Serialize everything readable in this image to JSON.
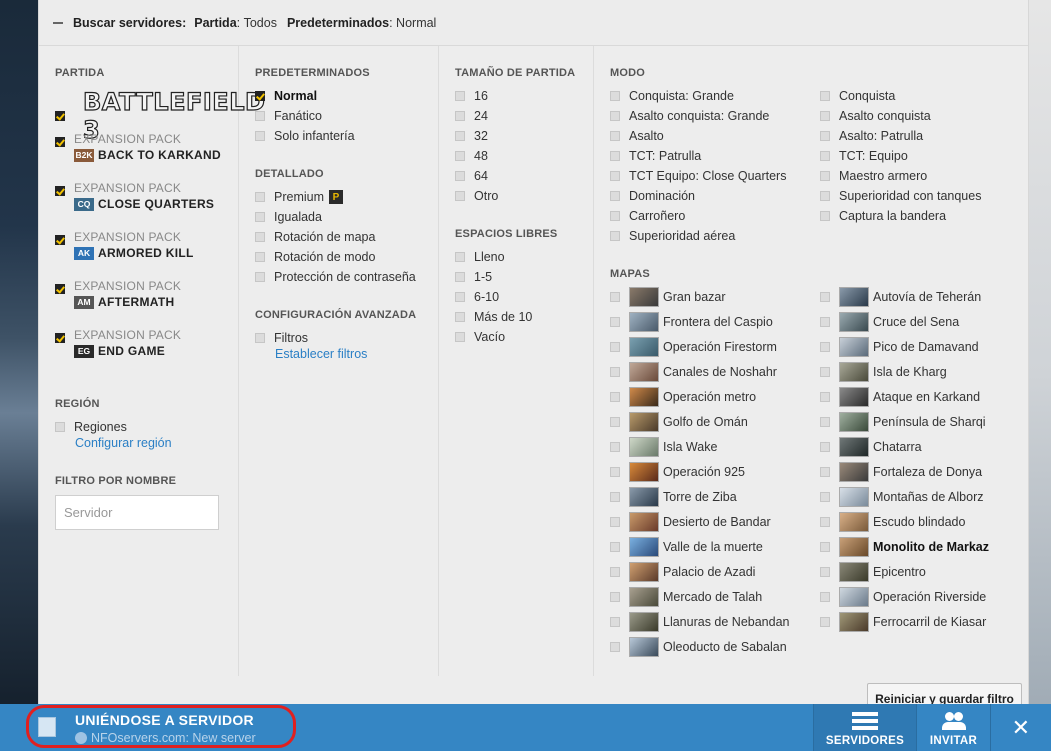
{
  "header": {
    "title": "Buscar servidores:",
    "partida_label": "Partida",
    "partida_value": "Todos",
    "predeterminados_label": "Predeterminados",
    "predeterminados_value": "Normal"
  },
  "partida": {
    "title": "PARTIDA",
    "base_logo": "BATTLEFIELD 3",
    "packs": [
      {
        "label": "EXPANSION PACK",
        "badge": "B2K",
        "badge_color": "#8a5a3a",
        "name": "BACK TO KARKAND"
      },
      {
        "label": "EXPANSION PACK",
        "badge": "CQ",
        "badge_color": "#3a6a8a",
        "name": "CLOSE QUARTERS"
      },
      {
        "label": "EXPANSION PACK",
        "badge": "AK",
        "badge_color": "#2e72b5",
        "name": "ARMORED KILL"
      },
      {
        "label": "EXPANSION PACK",
        "badge": "AM",
        "badge_color": "#555555",
        "name": "AFTERMATH"
      },
      {
        "label": "EXPANSION PACK",
        "badge": "EG",
        "badge_color": "#2a2a2a",
        "name": "END GAME"
      }
    ]
  },
  "region": {
    "title": "REGIÓN",
    "option": "Regiones",
    "link": "Configurar región"
  },
  "name_filter": {
    "title": "FILTRO POR NOMBRE",
    "placeholder": "Servidor"
  },
  "predeterminados": {
    "title": "PREDETERMINADOS",
    "options": [
      "Normal",
      "Fanático",
      "Solo infantería"
    ]
  },
  "detallado": {
    "title": "DETALLADO",
    "options": [
      "Premium",
      "Igualada",
      "Rotación de mapa",
      "Rotación de modo",
      "Protección de contraseña"
    ]
  },
  "avanzada": {
    "title": "CONFIGURACIÓN AVANZADA",
    "option": "Filtros",
    "link": "Establecer filtros"
  },
  "tamano": {
    "title": "TAMAÑO DE PARTIDA",
    "options": [
      "16",
      "24",
      "32",
      "48",
      "64",
      "Otro"
    ]
  },
  "espacios": {
    "title": "ESPACIOS LIBRES",
    "options": [
      "Lleno",
      "1-5",
      "6-10",
      "Más de 10",
      "Vacío"
    ]
  },
  "modo": {
    "title": "MODO",
    "left": [
      "Conquista: Grande",
      "Asalto conquista: Grande",
      "Asalto",
      "TCT: Patrulla",
      "TCT Equipo: Close Quarters",
      "Dominación",
      "Carroñero",
      "Superioridad aérea"
    ],
    "right": [
      "Conquista",
      "Asalto conquista",
      "Asalto: Patrulla",
      "TCT: Equipo",
      "Maestro armero",
      "Superioridad con tanques",
      "Captura la bandera"
    ]
  },
  "mapas": {
    "title": "MAPAS",
    "left": [
      "Gran bazar",
      "Frontera del Caspio",
      "Operación Firestorm",
      "Canales de Noshahr",
      "Operación metro",
      "Golfo de Omán",
      "Isla Wake",
      "Operación 925",
      "Torre de Ziba",
      "Desierto de Bandar",
      "Valle de la muerte",
      "Palacio de Azadi",
      "Mercado de Talah",
      "Llanuras de Nebandan",
      "Oleoducto de Sabalan"
    ],
    "right": [
      "Autovía de Teherán",
      "Cruce del Sena",
      "Pico de Damavand",
      "Isla de Kharg",
      "Ataque en Karkand",
      "Península de Sharqi",
      "Chatarra",
      "Fortaleza de Donya",
      "Montañas de Alborz",
      "Escudo blindado",
      "Monolito de Markaz",
      "Epicentro",
      "Operación Riverside",
      "Ferrocarril de Kiasar"
    ]
  },
  "reset_button": "Reiniciar y guardar filtro",
  "bottombar": {
    "title": "UNIÉNDOSE A SERVIDOR",
    "subtitle": "NFOservers.com: New server",
    "servers": "SERVIDORES",
    "invite": "INVITAR"
  }
}
